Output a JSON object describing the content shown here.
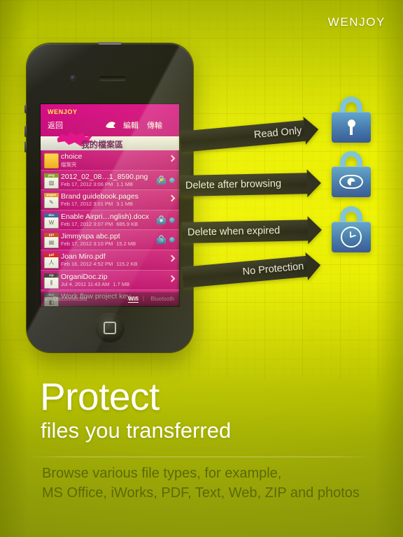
{
  "brand": {
    "name": "WENJOY"
  },
  "phone": {
    "app_brand": "WENJOY",
    "nav": {
      "back_label": "返回",
      "up_icon": "arrow-up-icon",
      "edit_label": "編輯",
      "transfer_label": "傳輸"
    },
    "title": "我的檔案區",
    "files": [
      {
        "icon": "folder-icon",
        "kind": "folder",
        "name": "choice",
        "meta_date": "檔案夾",
        "meta_size": "",
        "accessory": "chevron",
        "badge": ""
      },
      {
        "icon": "png-file-icon",
        "kind": "png",
        "name": "2012_02_08…1_8590.png",
        "meta_date": "Feb 17, 2012 3:06 PM",
        "meta_size": "1.1 MB",
        "accessory": "dot",
        "badge": "lock-keyhole-icon"
      },
      {
        "icon": "pages-file-icon",
        "kind": "pages",
        "name": "Brand guidebook.pages",
        "meta_date": "Feb 17, 2012 3:01 PM",
        "meta_size": "3.1 MB",
        "accessory": "chevron",
        "badge": ""
      },
      {
        "icon": "docx-file-icon",
        "kind": "doc",
        "name": "Enable Airpri…nglish).docx",
        "meta_date": "Feb 17, 2012 3:07 PM",
        "meta_size": "685.9 KB",
        "accessory": "dot",
        "badge": "lock-eye-icon"
      },
      {
        "icon": "ppt-file-icon",
        "kind": "ppt",
        "name": "Jimmyspa abc.ppt",
        "meta_date": "Feb 17, 2012 3:10 PM",
        "meta_size": "15.2 MB",
        "accessory": "dot",
        "badge": "lock-clock-icon"
      },
      {
        "icon": "pdf-file-icon",
        "kind": "pdf",
        "name": "Joan Miro.pdf",
        "meta_date": "Feb 16, 2012 4:52 PM",
        "meta_size": "115.2 KB",
        "accessory": "chevron",
        "badge": ""
      },
      {
        "icon": "zip-file-icon",
        "kind": "zip",
        "name": "OrganiDoc.zip",
        "meta_date": "Jul 4, 2011 11:43 AM",
        "meta_size": "1.7 MB",
        "accessory": "chevron",
        "badge": ""
      },
      {
        "icon": "key-file-icon",
        "kind": "key",
        "name": "Work flow project key",
        "meta_date": "",
        "meta_size": "",
        "accessory": "",
        "badge": ""
      }
    ],
    "status": {
      "wifi_icon": "wifi-icon",
      "connection": "Disconnected",
      "wifi_label": "Wifi",
      "separator": "|",
      "bluetooth_label": "Bluetooth"
    }
  },
  "callouts": [
    {
      "label": "Read Only",
      "lock_icon": "lock-keyhole-icon"
    },
    {
      "label": "Delete after browsing",
      "lock_icon": "lock-eye-icon"
    },
    {
      "label": "Delete when expired",
      "lock_icon": "lock-clock-icon"
    },
    {
      "label": "No Protection",
      "lock_icon": ""
    }
  ],
  "locks": [
    {
      "glyph": "keyhole-icon"
    },
    {
      "glyph": "eye-icon"
    },
    {
      "glyph": "clock-icon"
    }
  ],
  "footer": {
    "headline": "Protect",
    "subheadline": "files you transferred",
    "body_line1": "Browse various file types, for example,",
    "body_line2": "MS Office, iWorks, PDF, Text, Web, ZIP and photos"
  },
  "colors": {
    "yellow_bright": "#eef200",
    "olive": "#93a00a",
    "magenta": "#d6008c",
    "lock_blue": "#3a72b4",
    "shackle_blue": "#79c0dd",
    "callout_black": "#1b1b1b",
    "brand_white": "#ffffff"
  }
}
